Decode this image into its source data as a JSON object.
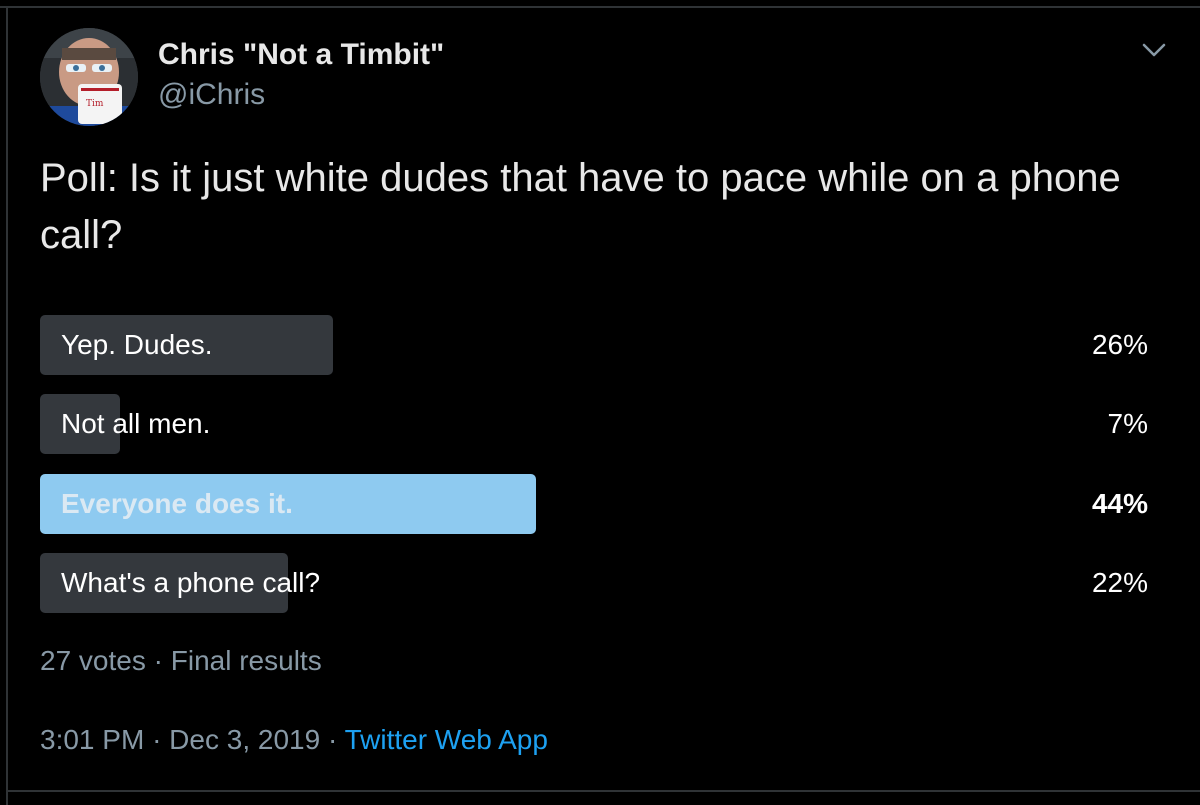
{
  "tweet": {
    "display_name": "Chris \"Not a Timbit\"",
    "handle": "@iChris",
    "text": "Poll: Is it just white dudes that have to pace while on a phone call?",
    "menu_icon": "chevron-down-icon",
    "avatar_icon": "avatar"
  },
  "poll": {
    "options": [
      {
        "label": "Yep. Dudes.",
        "percent_label": "26%",
        "percent": 26,
        "winner": false
      },
      {
        "label": "Not all men.",
        "percent_label": "7%",
        "percent": 7,
        "winner": false
      },
      {
        "label": "Everyone does it.",
        "percent_label": "44%",
        "percent": 44,
        "winner": true
      },
      {
        "label": "What's a phone call?",
        "percent_label": "22%",
        "percent": 22,
        "winner": false
      }
    ],
    "votes": "27 votes",
    "separator": "·",
    "status": "Final results"
  },
  "footer": {
    "time": "3:01 PM",
    "date": "Dec 3, 2019",
    "separator": "·",
    "source": "Twitter Web App"
  },
  "colors": {
    "background": "#000000",
    "bar": "#34383d",
    "winner_bar": "#8ecaf0",
    "link": "#1da1f2",
    "muted": "#8899a6"
  }
}
